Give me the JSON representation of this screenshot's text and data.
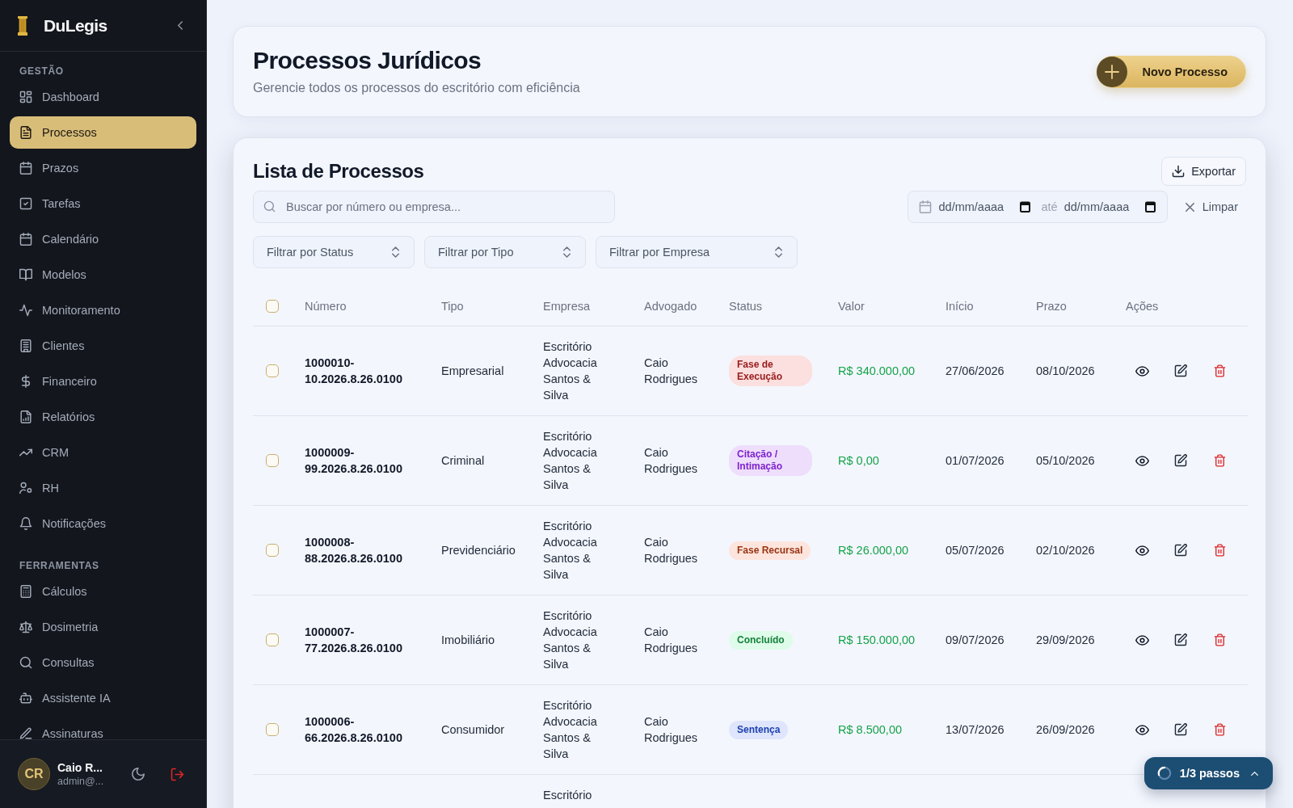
{
  "sidebar": {
    "brand": "DuLegis",
    "sections": [
      {
        "title": "GESTÃO",
        "items": [
          {
            "label": "Dashboard",
            "selected": false
          },
          {
            "label": "Processos",
            "selected": true
          },
          {
            "label": "Prazos",
            "selected": false
          },
          {
            "label": "Tarefas",
            "selected": false
          },
          {
            "label": "Calendário",
            "selected": false
          },
          {
            "label": "Modelos",
            "selected": false
          },
          {
            "label": "Monitoramento",
            "selected": false
          },
          {
            "label": "Clientes",
            "selected": false
          },
          {
            "label": "Financeiro",
            "selected": false
          },
          {
            "label": "Relatórios",
            "selected": false
          },
          {
            "label": "CRM",
            "selected": false
          },
          {
            "label": "RH",
            "selected": false
          },
          {
            "label": "Notificações",
            "selected": false
          }
        ]
      },
      {
        "title": "FERRAMENTAS",
        "items": [
          {
            "label": "Cálculos",
            "selected": false
          },
          {
            "label": "Dosimetria",
            "selected": false
          },
          {
            "label": "Consultas",
            "selected": false
          },
          {
            "label": "Assistente IA",
            "selected": false
          },
          {
            "label": "Assinaturas",
            "selected": false
          }
        ]
      }
    ],
    "user": {
      "initials": "CR",
      "name": "Caio R...",
      "email": "admin@..."
    }
  },
  "header": {
    "title": "Processos Jurídicos",
    "subtitle": "Gerencie todos os processos do escritório com eficiência",
    "new_button": "Novo Processo"
  },
  "list": {
    "title": "Lista de Processos",
    "export_button": "Exportar",
    "search": {
      "placeholder": "Buscar por número ou empresa..."
    },
    "date_range": {
      "start": {
        "placeholder": "dd/mm/aaaa"
      },
      "separator": "até",
      "end": {
        "placeholder": "dd/mm/aaaa"
      }
    },
    "clear_button": "Limpar",
    "filters": [
      {
        "placeholder": "Filtrar por Status"
      },
      {
        "placeholder": "Filtrar por Tipo"
      },
      {
        "placeholder": "Filtrar por Empresa"
      }
    ],
    "table": {
      "select_all": {
        "checked": false
      },
      "columns": [
        "Número",
        "Tipo",
        "Empresa",
        "Advogado",
        "Status",
        "Valor",
        "Início",
        "Prazo",
        "Ações"
      ],
      "rows": [
        {
          "selected": false,
          "number": "1000010-10.2026.8.26.0100",
          "type": "Empresarial",
          "company": "Escritório Advocacia Santos & Silva",
          "lawyer": "Caio Rodrigues",
          "status": {
            "label": "Fase de Execução",
            "color": "#991b1b"
          },
          "value": "R$ 340.000,00",
          "start": "27/06/2026",
          "deadline": "08/10/2026"
        },
        {
          "selected": false,
          "number": "1000009-99.2026.8.26.0100",
          "type": "Criminal",
          "company": "Escritório Advocacia Santos & Silva",
          "lawyer": "Caio Rodrigues",
          "status": {
            "label": "Citação / Intimação",
            "color": "#7e22ce"
          },
          "value": "R$ 0,00",
          "start": "01/07/2026",
          "deadline": "05/10/2026"
        },
        {
          "selected": false,
          "number": "1000008-88.2026.8.26.0100",
          "type": "Previdenciário",
          "company": "Escritório Advocacia Santos & Silva",
          "lawyer": "Caio Rodrigues",
          "status": {
            "label": "Fase Recursal",
            "color": "#9a3412"
          },
          "value": "R$ 26.000,00",
          "start": "05/07/2026",
          "deadline": "02/10/2026"
        },
        {
          "selected": false,
          "number": "1000007-77.2026.8.26.0100",
          "type": "Imobiliário",
          "company": "Escritório Advocacia Santos & Silva",
          "lawyer": "Caio Rodrigues",
          "status": {
            "label": "Concluído",
            "color": "#15803d"
          },
          "value": "R$ 150.000,00",
          "start": "09/07/2026",
          "deadline": "29/09/2026"
        },
        {
          "selected": false,
          "number": "1000006-66.2026.8.26.0100",
          "type": "Consumidor",
          "company": "Escritório Advocacia Santos & Silva",
          "lawyer": "Caio Rodrigues",
          "status": {
            "label": "Sentença",
            "color": "#1e40af"
          },
          "value": "R$ 8.500,00",
          "start": "13/07/2026",
          "deadline": "26/09/2026"
        },
        {
          "company": "Escritório"
        }
      ]
    }
  },
  "tour": {
    "label": "1/3 passos"
  }
}
